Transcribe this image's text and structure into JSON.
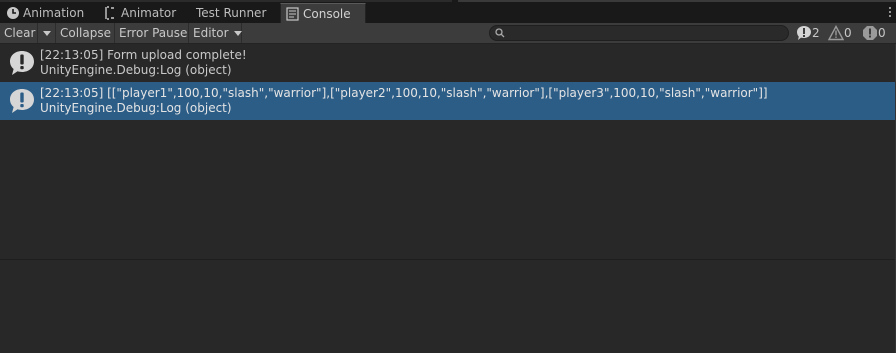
{
  "tabs": [
    {
      "label": "Animation",
      "icon": "clock-icon",
      "active": false
    },
    {
      "label": "Animator",
      "icon": "animator-icon",
      "active": false
    },
    {
      "label": "Test Runner",
      "icon": "",
      "active": false
    },
    {
      "label": "Console",
      "icon": "console-icon",
      "active": true
    }
  ],
  "toolbar": {
    "clear_label": "Clear",
    "collapse_label": "Collapse",
    "error_pause_label": "Error Pause",
    "editor_label": "Editor",
    "search_placeholder": "",
    "log_count": "2",
    "warning_count": "0",
    "error_count": "0"
  },
  "entries": [
    {
      "icon": "info-icon",
      "line1": "[22:13:05] Form upload complete!",
      "line2": "UnityEngine.Debug:Log (object)",
      "selected": false
    },
    {
      "icon": "info-icon",
      "line1": "[22:13:05] [[\"player1\",100,10,\"slash\",\"warrior\"],[\"player2\",100,10,\"slash\",\"warrior\"],[\"player3\",100,10,\"slash\",\"warrior\"]]",
      "line2": "UnityEngine.Debug:Log (object)",
      "selected": true
    }
  ],
  "colors": {
    "selection": "#2c5d87",
    "panel": "#282828",
    "toolbar": "#3c3c3c"
  }
}
